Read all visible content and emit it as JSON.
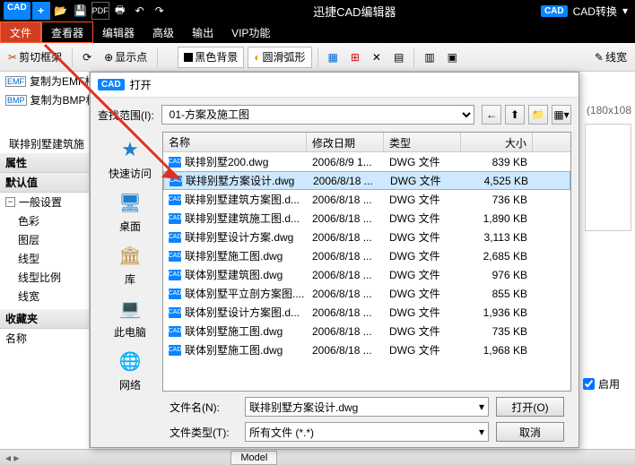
{
  "app": {
    "title": "迅捷CAD编辑器",
    "convert": "CAD转换"
  },
  "menu": [
    "文件",
    "查看器",
    "编辑器",
    "高级",
    "输出",
    "VIP功能"
  ],
  "toolbar": {
    "cut_frame": "剪切框架",
    "copy_emf": "复制为EMF格",
    "copy_bmp": "复制为BMP格",
    "show_points": "显示点",
    "black_bg": "黑色背景",
    "smooth_arc": "圆滑弧形",
    "linewidth": "线宽"
  },
  "left": {
    "doc_name": "联排别墅建筑施",
    "props": "属性",
    "default": "默认值",
    "general": "一般设置",
    "items": [
      "色彩",
      "图层",
      "线型",
      "线型比例",
      "线宽"
    ],
    "fav": "收藏夹",
    "name": "名称"
  },
  "dialog": {
    "title": "打开",
    "range_label": "查找范围(I):",
    "folder": "01-方案及施工图",
    "sidebar": [
      "快速访问",
      "桌面",
      "库",
      "此电脑",
      "网络"
    ],
    "cols": [
      "名称",
      "修改日期",
      "类型",
      "大小"
    ],
    "files": [
      {
        "name": "联排别墅200.dwg",
        "date": "2006/8/9 1...",
        "type": "DWG 文件",
        "size": "839 KB"
      },
      {
        "name": "联排别墅方案设计.dwg",
        "date": "2006/8/18 ...",
        "type": "DWG 文件",
        "size": "4,525 KB",
        "sel": true
      },
      {
        "name": "联排别墅建筑方案图.d...",
        "date": "2006/8/18 ...",
        "type": "DWG 文件",
        "size": "736 KB"
      },
      {
        "name": "联排别墅建筑施工图.d...",
        "date": "2006/8/18 ...",
        "type": "DWG 文件",
        "size": "1,890 KB"
      },
      {
        "name": "联排别墅设计方案.dwg",
        "date": "2006/8/18 ...",
        "type": "DWG 文件",
        "size": "3,113 KB"
      },
      {
        "name": "联排别墅施工图.dwg",
        "date": "2006/8/18 ...",
        "type": "DWG 文件",
        "size": "2,685 KB"
      },
      {
        "name": "联体别墅建筑图.dwg",
        "date": "2006/8/18 ...",
        "type": "DWG 文件",
        "size": "976 KB"
      },
      {
        "name": "联体别墅平立剖方案图....",
        "date": "2006/8/18 ...",
        "type": "DWG 文件",
        "size": "855 KB"
      },
      {
        "name": "联体别墅设计方案图.d...",
        "date": "2006/8/18 ...",
        "type": "DWG 文件",
        "size": "1,936 KB"
      },
      {
        "name": "联体别墅施工图.dwg",
        "date": "2006/8/18 ...",
        "type": "DWG 文件",
        "size": "735 KB"
      },
      {
        "name": "联体别墅施工图.dwg",
        "date": "2006/8/18 ...",
        "type": "DWG 文件",
        "size": "1,968 KB"
      }
    ],
    "filename_label": "文件名(N):",
    "filename_value": "联排别墅方案设计.dwg",
    "filetype_label": "文件类型(T):",
    "filetype_value": "所有文件 (*.*)",
    "open_btn": "打开(O)",
    "cancel_btn": "取消"
  },
  "right": {
    "dims": "(180x108",
    "enable": "启用"
  },
  "status": {
    "model": "Model"
  }
}
